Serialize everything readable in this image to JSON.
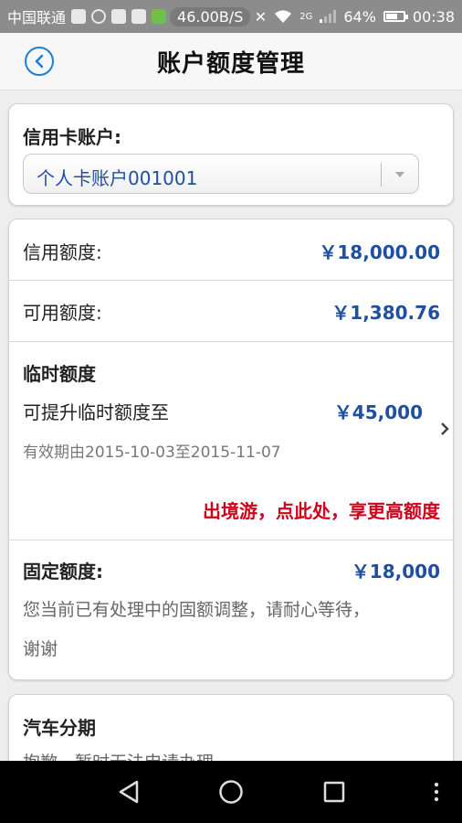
{
  "status_bar": {
    "carrier": "中国联通",
    "speed": "46.00B/S",
    "network": "2G",
    "battery": "64%",
    "time": "00:38"
  },
  "header": {
    "title": "账户额度管理",
    "back_icon": "chevron-left-icon"
  },
  "account": {
    "label": "信用卡账户:",
    "selected": "个人卡账户001001"
  },
  "credit_limit": {
    "label": "信用额度:",
    "value": "￥18,000.00"
  },
  "available_limit": {
    "label": "可用额度:",
    "value": "￥1,380.76"
  },
  "temp_limit": {
    "title": "临时额度",
    "raise_label": "可提升临时额度至",
    "raise_value": "￥45,000",
    "validity": "有效期由2015-10-03至2015-11-07",
    "promo": "出境游，点此处，享更高额度"
  },
  "fixed_limit": {
    "label": "固定额度:",
    "value": "￥18,000",
    "note_line1": "您当前已有处理中的固额调整，请耐心等待，",
    "note_line2": "谢谢"
  },
  "car_installment": {
    "title": "汽车分期",
    "note": "抱歉，暂时无法申请办理"
  },
  "colors": {
    "amount": "#1f4f9e",
    "promo": "#d0021b",
    "accent": "#1c7fd6"
  }
}
